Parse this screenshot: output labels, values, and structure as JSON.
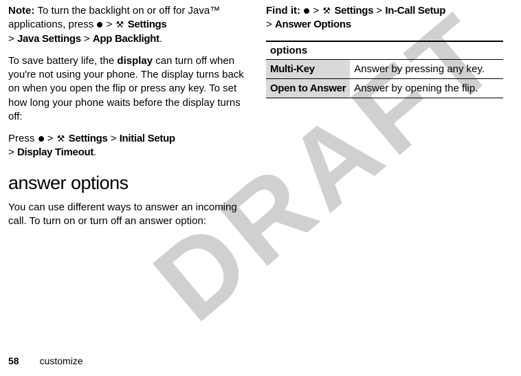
{
  "watermark": "DRAFT",
  "left": {
    "note_label": "Note: ",
    "note_text1": "To turn the backlight on or off for Java™ applications, press ",
    "note_path1": "Settings",
    "note_path2": "Java Settings",
    "note_path3": "App Backlight",
    "para2a": "To save battery life, the ",
    "para2_bold": "display",
    "para2b": " can turn off when you're not using your phone. The display turns back on when you open the flip or press any key. To set how long your phone waits before the display turns off:",
    "press_label": "Press ",
    "press_path1": "Settings",
    "press_path2": "Initial Setup",
    "press_path3": "Display Timeout",
    "section_heading": "answer options",
    "para3": "You can use different ways to answer an incoming call. To turn on or turn off an answer option:"
  },
  "right": {
    "findit_label": "Find it: ",
    "findit_path1": "Settings",
    "findit_path2": "In-Call Setup",
    "findit_path3": "Answer Options",
    "table_header": "options",
    "rows": [
      {
        "label": "Multi-Key",
        "desc": "Answer by pressing any key."
      },
      {
        "label": "Open to Answer",
        "desc": "Answer by opening the flip."
      }
    ]
  },
  "footer": {
    "page": "58",
    "section": "customize"
  },
  "gt": ">"
}
